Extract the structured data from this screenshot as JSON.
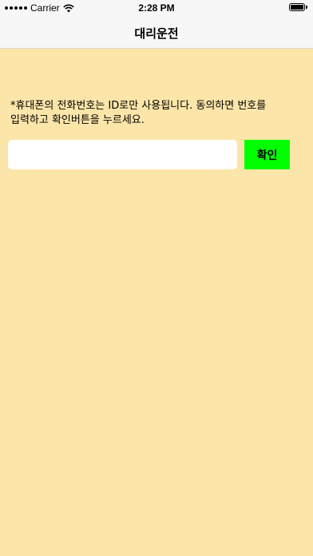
{
  "status_bar": {
    "carrier": "Carrier",
    "time": "2:28 PM",
    "wifi_icon": "wifi-icon",
    "battery_icon": "battery-icon",
    "battery_level": 1.0
  },
  "nav": {
    "title": "대리운전"
  },
  "main": {
    "notice": "*휴대폰의 전화번호는 ID로만 사용됩니다. 동의하면 번호를 입력하고 확인버튼을 누르세요.",
    "phone_input": {
      "value": "",
      "placeholder": ""
    },
    "confirm_label": "확인"
  },
  "colors": {
    "background": "#fce5a8",
    "nav_background": "#f7f7f7",
    "confirm_button": "#00ff00",
    "input_background": "#ffffff"
  }
}
